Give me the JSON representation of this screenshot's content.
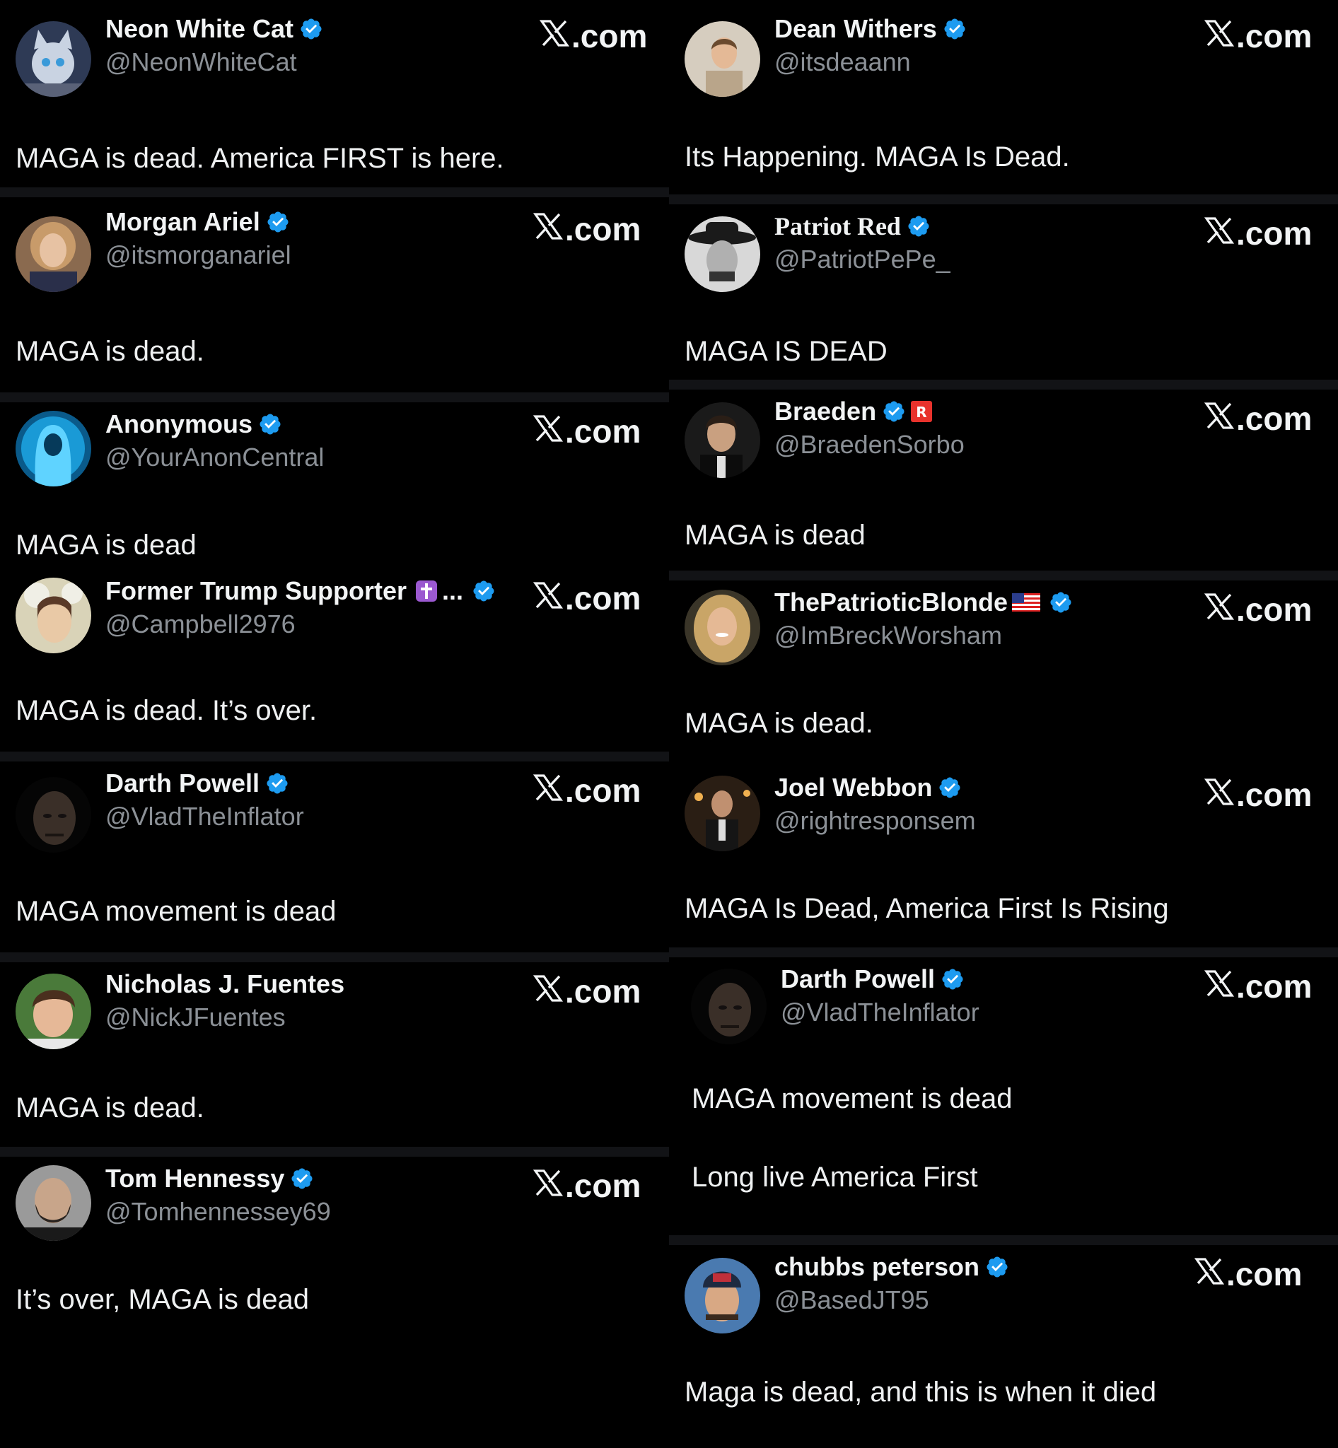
{
  "site_label": ".com",
  "colors": {
    "background": "#000000",
    "verified": "#1d9bf0",
    "handle": "#8b9096",
    "separator": "#121316"
  },
  "left": [
    {
      "name": "Neon White Cat",
      "handle": "@NeonWhiteCat",
      "text": "MAGA is dead. America FIRST is here.",
      "avatar": "cat-avatar"
    },
    {
      "name": "Morgan Ariel",
      "handle": "@itsmorganariel",
      "text": "MAGA is dead.",
      "avatar": "woman-avatar"
    },
    {
      "name": "Anonymous",
      "handle": "@YourAnonCentral",
      "text": "MAGA is dead",
      "avatar": "hooded-figure-avatar"
    },
    {
      "name": "Former Trump Supporter",
      "ellipsis": "...",
      "handle": "@Campbell2976",
      "text": "MAGA is dead. It’s over.",
      "avatar": "painting-avatar",
      "emoji": "cross-emoji-icon"
    },
    {
      "name": "Darth Powell",
      "handle": "@VladTheInflator",
      "text": "MAGA movement is dead",
      "avatar": "dark-face-avatar"
    },
    {
      "name": "Nicholas J. Fuentes",
      "handle": "@NickJFuentes",
      "text": "MAGA is dead.",
      "avatar": "man-avatar"
    },
    {
      "name": "Tom Hennessy",
      "handle": "@Tomhennessey69",
      "text": "It’s over, MAGA is dead",
      "avatar": "bearded-man-avatar"
    }
  ],
  "right": [
    {
      "name": "Dean Withers",
      "handle": "@itsdeaann",
      "text": "Its Happening. MAGA Is Dead.",
      "avatar": "selfie-avatar"
    },
    {
      "name": "Patriot Red",
      "handle": "@PatriotPePe_",
      "text": "MAGA IS DEAD",
      "avatar": "cowboy-avatar"
    },
    {
      "name": "Braeden",
      "handle": "@BraedenSorbo",
      "text": "MAGA is dead",
      "avatar": "young-man-avatar",
      "emoji": "r-badge-icon"
    },
    {
      "name": "ThePatrioticBlonde",
      "handle": "@ImBreckWorsham",
      "text": "MAGA is dead.",
      "avatar": "blonde-woman-avatar",
      "emoji": "us-flag-icon"
    },
    {
      "name": "Joel Webbon",
      "handle": "@rightresponsem",
      "text": "MAGA Is Dead, America First Is Rising",
      "avatar": "suit-man-avatar"
    },
    {
      "name": "Darth Powell",
      "handle": "@VladTheInflator",
      "text": "MAGA movement is dead",
      "text2": "Long live America First",
      "avatar": "dark-face-avatar"
    },
    {
      "name": "chubbs peterson",
      "handle": "@BasedJT95",
      "text": "Maga is dead, and this is when it died",
      "avatar": "cap-man-avatar"
    }
  ]
}
